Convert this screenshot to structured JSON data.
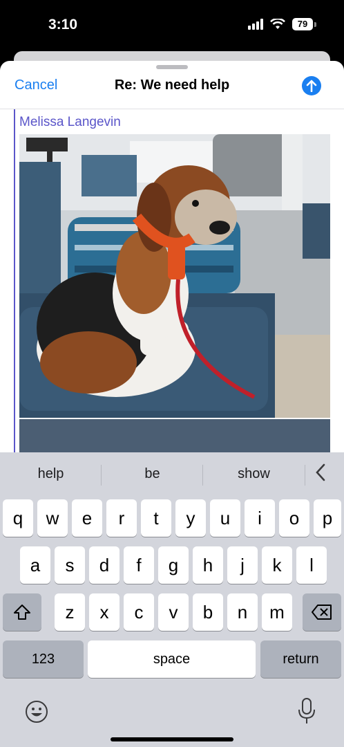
{
  "status": {
    "time": "3:10",
    "battery": "79"
  },
  "compose": {
    "cancel_label": "Cancel",
    "subject": "Re: We need help",
    "send_icon": "arrow-up-icon",
    "sender": "Melissa Langevin"
  },
  "keyboard": {
    "suggestions": [
      "help",
      "be",
      "show"
    ],
    "row1": [
      "q",
      "w",
      "e",
      "r",
      "t",
      "y",
      "u",
      "i",
      "o",
      "p"
    ],
    "row2": [
      "a",
      "s",
      "d",
      "f",
      "g",
      "h",
      "j",
      "k",
      "l"
    ],
    "row3": [
      "z",
      "x",
      "c",
      "v",
      "b",
      "n",
      "m"
    ],
    "numbers_label": "123",
    "space_label": "space",
    "return_label": "return",
    "icons": [
      "shift-icon",
      "delete-icon",
      "emoji-icon",
      "microphone-icon",
      "chevron-left-icon"
    ]
  },
  "colors": {
    "accent": "#1a7ff0",
    "quote": "#5a55c9"
  }
}
